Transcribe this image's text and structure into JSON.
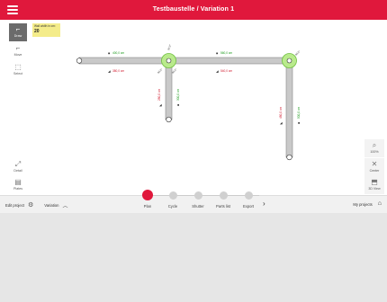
{
  "header": {
    "title": "Testbaustelle / Variation 1"
  },
  "left_tools": {
    "items": [
      {
        "label": "Draw",
        "icon": "draw-wall-icon"
      },
      {
        "label": "Move",
        "icon": "move-icon"
      },
      {
        "label": "Select",
        "icon": "select-icon"
      }
    ],
    "bottom": [
      {
        "label": "Detail",
        "icon": "detail-icon"
      },
      {
        "label": "Plates",
        "icon": "plates-icon"
      }
    ]
  },
  "note": {
    "label": "Wall width in cm:",
    "value": "20"
  },
  "right_tools": [
    {
      "label": "100%",
      "icon": "zoom-icon"
    },
    {
      "label": "Center",
      "icon": "center-icon"
    },
    {
      "label": "3D View",
      "icon": "3d-view-icon"
    }
  ],
  "plan": {
    "dim_top_green_1": "400,0 cm",
    "dim_top_red_1": "380,0 cm",
    "dim_top_green_2": "560,0 cm",
    "dim_top_red_2": "540,0 cm",
    "dim_left_red": "280,0 cm",
    "dim_left_green": "300,0 cm",
    "dim_right_red": "480,0 cm",
    "dim_right_green": "500,0 cm",
    "angle_a": "90,0°",
    "angle_b": "90,0°",
    "angle_c": "90,0°",
    "angle_d": "90,0°"
  },
  "footer": {
    "edit_project": "Edit project",
    "variation": "Variation",
    "my_projects": "My projects"
  },
  "steps": [
    {
      "label": "Plan"
    },
    {
      "label": "Cycle"
    },
    {
      "label": "Shutter"
    },
    {
      "label": "Parts list"
    },
    {
      "label": "Export"
    }
  ]
}
